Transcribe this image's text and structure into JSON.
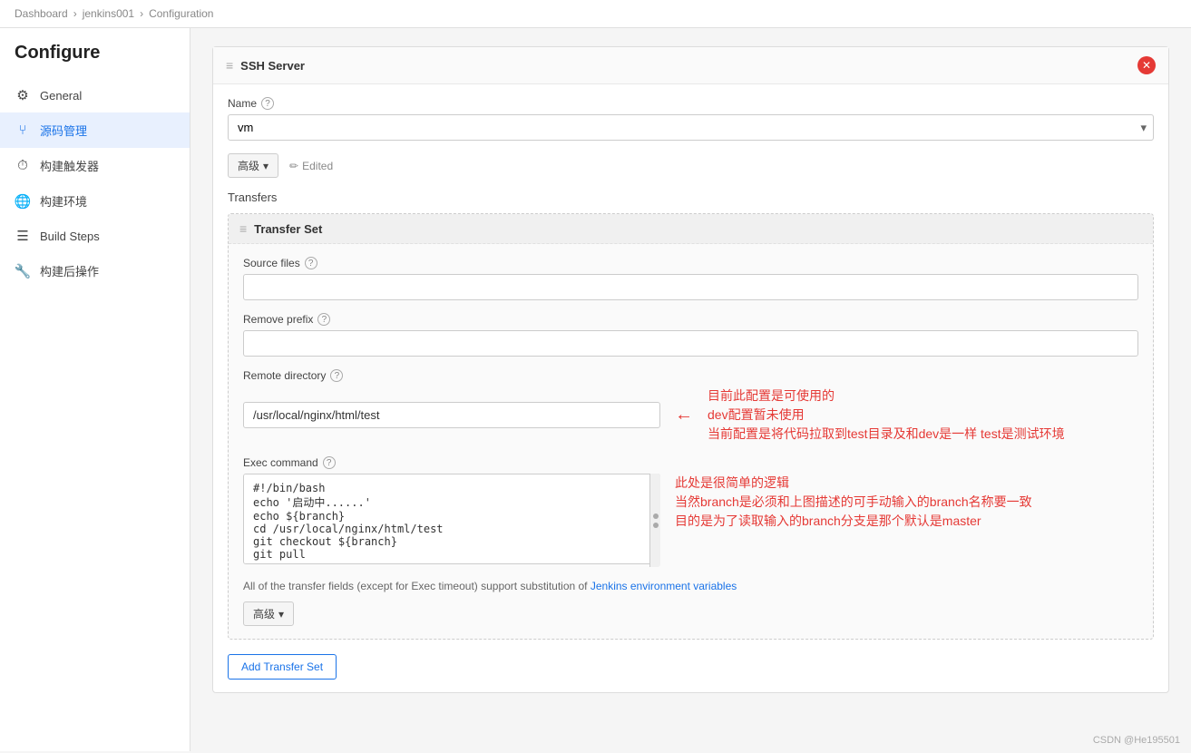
{
  "breadcrumb": {
    "items": [
      "Dashboard",
      "jenkins001",
      "Configuration"
    ]
  },
  "sidebar": {
    "title": "Configure",
    "items": [
      {
        "id": "general",
        "label": "General",
        "icon": "⚙"
      },
      {
        "id": "source",
        "label": "源码管理",
        "icon": "⑂",
        "active": true
      },
      {
        "id": "triggers",
        "label": "构建触发器",
        "icon": "⏱"
      },
      {
        "id": "environment",
        "label": "构建环境",
        "icon": "🌐"
      },
      {
        "id": "build-steps",
        "label": "Build Steps",
        "icon": "☰"
      },
      {
        "id": "post-build",
        "label": "构建后操作",
        "icon": "🔧"
      }
    ]
  },
  "ssh_server": {
    "header": "SSH Server",
    "name_label": "Name",
    "name_help": "?",
    "name_value": "vm",
    "advanced_btn": "高级",
    "edited_label": "Edited",
    "transfers_label": "Transfers",
    "transfer_set_header": "Transfer Set",
    "source_files_label": "Source files",
    "source_files_help": "?",
    "source_files_value": "",
    "remove_prefix_label": "Remove prefix",
    "remove_prefix_help": "?",
    "remove_prefix_value": "",
    "remote_dir_label": "Remote directory",
    "remote_dir_help": "?",
    "remote_dir_value": "/usr/local/nginx/html/test",
    "exec_command_label": "Exec command",
    "exec_command_help": "?",
    "exec_command_value": "#!/bin/bash\necho '启动中......'\necho ${branch}\ncd /usr/local/nginx/html/test\ngit checkout ${branch}\ngit pull",
    "transfer_note": "All of the transfer fields (except for Exec timeout) support substitution of",
    "transfer_note_link": "Jenkins environment variables",
    "advanced_btn2": "高级",
    "add_transfer_btn": "Add Transfer Set"
  },
  "annotations": {
    "remote_dir_anno1": "目前此配置是可使用的",
    "remote_dir_anno2": "dev配置暂未使用",
    "remote_dir_anno3": "当前配置是将代码拉取到test目录及和dev是一样 test是测试环境",
    "exec_anno1": "此处是很简单的逻辑",
    "exec_anno2": "当然branch是必须和上图描述的可手动输入的branch名称要一致",
    "exec_anno3": "目的是为了读取输入的branch分支是那个默认是master"
  },
  "watermark": "CSDN @He195501"
}
